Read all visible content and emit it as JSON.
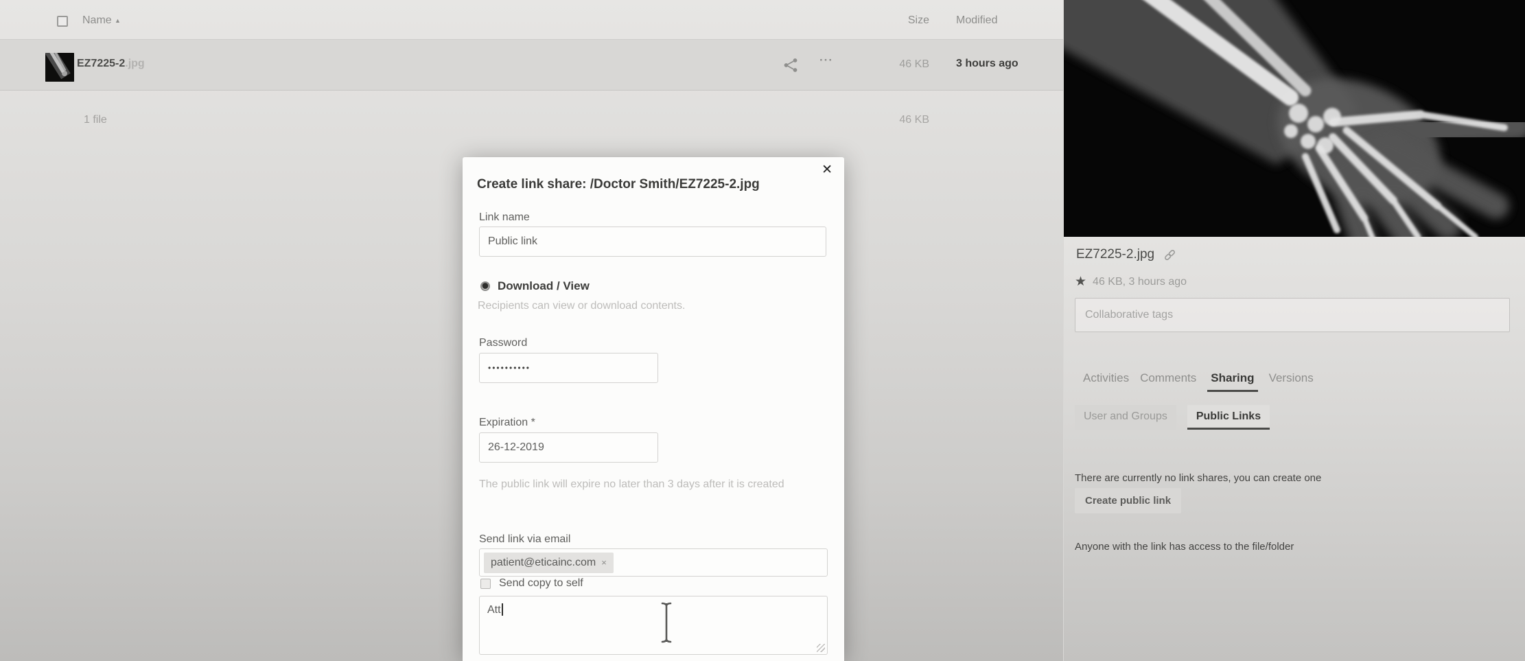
{
  "file_list": {
    "header": {
      "name": "Name",
      "size": "Size",
      "modified": "Modified"
    },
    "row": {
      "name": "EZ7225-2",
      "ext": ".jpg",
      "size": "46 KB",
      "modified": "3 hours ago"
    },
    "summary": {
      "count": "1 file",
      "size": "46 KB"
    }
  },
  "dialog": {
    "title": "Create link share: /Doctor Smith/EZ7225-2.jpg",
    "link_name_label": "Link name",
    "link_name_value": "Public link",
    "permission_label": "Download / View",
    "permission_help": "Recipients can view or download contents.",
    "password_label": "Password",
    "password_value": "••••••••••",
    "expiration_label": "Expiration *",
    "expiration_value": "26-12-2019",
    "expiration_help": "The public link will expire no later than 3 days after it is created",
    "email_label": "Send link via email",
    "email_chip": "patient@eticainc.com",
    "send_copy_label": "Send copy to self",
    "message_value": "Att"
  },
  "sidebar": {
    "file_name": "EZ7225-2.jpg",
    "file_meta": "46 KB, 3 hours ago",
    "tags_placeholder": "Collaborative tags",
    "tabs": [
      {
        "label": "Activities"
      },
      {
        "label": "Comments"
      },
      {
        "label": "Sharing"
      },
      {
        "label": "Versions"
      }
    ],
    "subtabs": [
      {
        "label": "User and Groups"
      },
      {
        "label": "Public Links"
      }
    ],
    "empty_text": "There are currently no link shares, you can create one",
    "create_button_label": "Create public link",
    "access_note": "Anyone with the link has access to the file/folder"
  },
  "icons": {
    "sort_asc": "▲",
    "more": "···",
    "close": "✕",
    "star": "★",
    "chip_remove": "×"
  }
}
